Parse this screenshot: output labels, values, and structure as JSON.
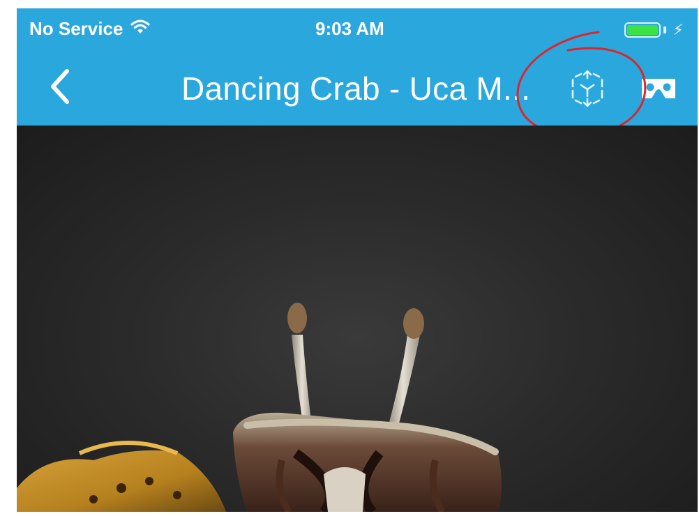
{
  "status_bar": {
    "carrier": "No Service",
    "time": "9:03 AM",
    "icons": [
      "wifi-icon",
      "battery-icon",
      "charging-bolt-icon"
    ],
    "battery_color": "#3be244"
  },
  "nav": {
    "back_icon": "chevron-left-icon",
    "title": "Dancing Crab - Uca M...",
    "ar_button_icon": "ar-cube-icon",
    "vr_button_icon": "vr-headset-icon",
    "bar_color": "#2aa7dd"
  },
  "annotation": {
    "shape": "hand-drawn circle around AR button",
    "color": "#e0242a"
  },
  "viewer": {
    "subject": "3D crab model"
  }
}
